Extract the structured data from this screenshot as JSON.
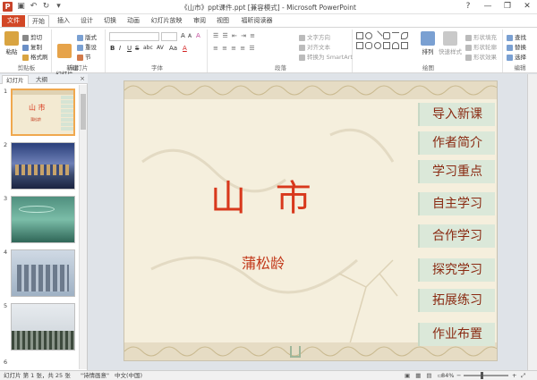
{
  "window": {
    "title": "《山市》ppt课件.ppt [兼容模式] - Microsoft PowerPoint",
    "app_icon": "P",
    "qat": [
      "save-icon",
      "undo-icon",
      "redo-icon",
      "customize-icon"
    ],
    "controls": [
      "help-icon",
      "minimize-icon",
      "restore-icon",
      "close-icon"
    ]
  },
  "tabs": [
    "文件",
    "开始",
    "插入",
    "设计",
    "切换",
    "动画",
    "幻灯片放映",
    "审阅",
    "视图",
    "福昕阅读器"
  ],
  "ribbon": {
    "clipboard": {
      "paste": "粘贴",
      "cut": "剪切",
      "copy": "复制",
      "painter": "格式刷",
      "label": "剪贴板"
    },
    "slides": {
      "new_slide": "新建\n幻灯片",
      "layout": "版式",
      "reset": "重设",
      "section": "节",
      "label": "幻灯片"
    },
    "font": {
      "size_a": "A",
      "size_b": "A",
      "clear": "A",
      "bold": "B",
      "italic": "I",
      "underline": "U",
      "strike": "S",
      "abc": "abc",
      "spacing": "AV",
      "case": "Aa",
      "color": "A",
      "label": "字体"
    },
    "paragraph": {
      "direction": "文字方向",
      "align_text": "对齐文本",
      "smartart": "转换为 SmartArt",
      "label": "段落"
    },
    "drawing": {
      "arrange": "排列",
      "quick_styles": "快速样式",
      "fill": "形状填充",
      "outline": "形状轮廓",
      "effects": "形状效果",
      "label": "绘图"
    },
    "editing": {
      "find": "查找",
      "replace": "替换",
      "select": "选择",
      "label": "编辑"
    }
  },
  "left_pane": {
    "tabs": [
      "幻灯片",
      "大纲"
    ],
    "close": "×",
    "slides": [
      {
        "num": "1",
        "title": "山 市",
        "sub": "蒲松龄"
      },
      {
        "num": "2"
      },
      {
        "num": "3"
      },
      {
        "num": "4"
      },
      {
        "num": "5"
      }
    ],
    "extra": "6"
  },
  "slide": {
    "title": "山 市",
    "author": "蒲松龄",
    "menu": [
      "导入新课",
      "作者简介",
      "学习重点",
      "自主学习",
      "合作学习",
      "探究学习",
      "拓展练习",
      "作业布置"
    ]
  },
  "status": {
    "slide": "幻灯片 第 1 张，共 25 张",
    "theme": "\"诗情画意\"",
    "lang": "中文(中国)",
    "zoom": "84%"
  },
  "colors": {
    "accent": "#d24726",
    "title_red": "#d8381c",
    "menu_bg": "#dbe8d9",
    "slide_bg": "#f5efdd"
  }
}
